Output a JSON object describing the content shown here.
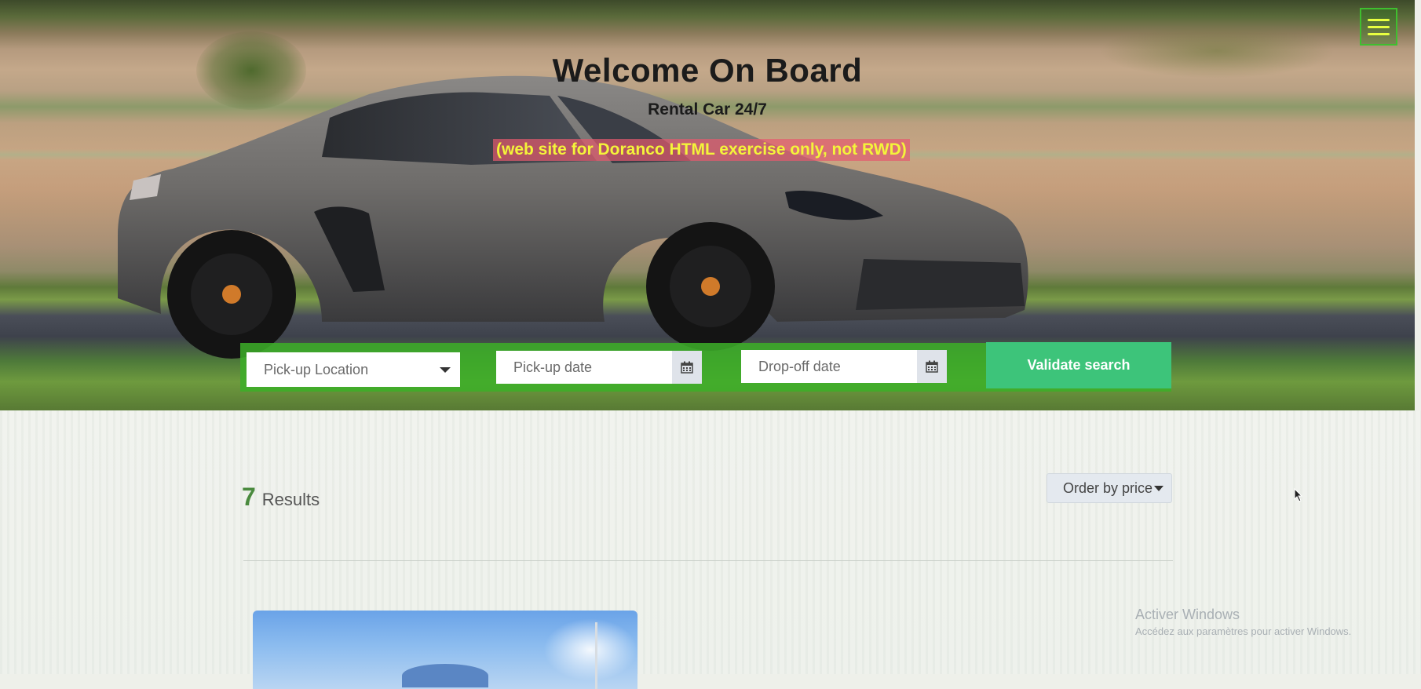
{
  "header": {
    "menu_icon": "hamburger-icon",
    "title": "Welcome On Board",
    "subtitle": "Rental Car 24/7",
    "note": "(web site for Doranco HTML exercise only, not RWD)"
  },
  "search": {
    "location_placeholder": "Pick-up Location",
    "pickup_placeholder": "Pick-up date",
    "dropoff_placeholder": "Drop-off date",
    "calendar_icon": "calendar-icon",
    "validate_label": "Validate search"
  },
  "results": {
    "count": "7",
    "label": "Results",
    "order_label": "Order by price"
  },
  "watermark": {
    "line1": "Activer Windows",
    "line2": "Accédez aux paramètres pour activer Windows."
  },
  "colors": {
    "search_bar": "#3caf28",
    "validate_button": "#3dc47a",
    "note_text": "#f4f43a",
    "result_count": "#4a8a3e"
  }
}
